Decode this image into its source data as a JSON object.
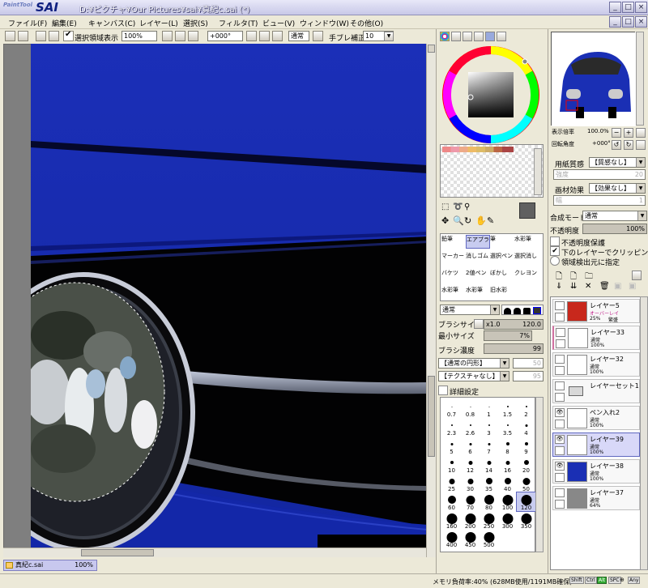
{
  "app": {
    "logo_small": "PaintTool",
    "logo_big": "SAI",
    "title": "D:¥ピクチャ¥Our Pictures¥sai¥真紀c.sai (*)"
  },
  "window_buttons": [
    "_",
    "□",
    "×"
  ],
  "menu": [
    "ファイル(F)",
    "編集(E)",
    "キャンバス(C)",
    "レイヤー(L)",
    "選択(S)",
    "フィルタ(T)",
    "ビュー(V)",
    "ウィンドウ(W)",
    "その他(O)"
  ],
  "toolbar": {
    "selection_show": "選択領域表示",
    "zoom": "100%",
    "angle": "+000°",
    "blend": "通常",
    "stabilizer_label": "手ブレ補正",
    "stabilizer_value": "10"
  },
  "navigator": {
    "zoom_label": "表示倍率",
    "zoom_value": "100.0%",
    "rotate_label": "回転角度",
    "rotate_value": "+000°"
  },
  "paper": {
    "texture_label": "用紙質感",
    "texture_value": "【質感なし】",
    "texture_sub": "強度",
    "texture_sub_value": "20",
    "effect_label": "画材効果",
    "effect_value": "【効果なし】",
    "effect_sub": "幅",
    "effect_sub_value": "1"
  },
  "layer_props": {
    "mode_label": "合成モード",
    "mode_value": "通常",
    "opacity_label": "不透明度",
    "opacity_value": "100%",
    "check1": "不透明度保護",
    "check2": "下のレイヤーでクリッピング",
    "check3": "領域検出元に指定"
  },
  "tools": [
    [
      "鉛筆",
      "エアブラシ",
      "筆",
      "水彩筆"
    ],
    [
      "マーカー",
      "消しゴム",
      "選択ペン",
      "選択消し"
    ],
    [
      "バケツ",
      "2値ペン",
      "ぼかし",
      "クレヨン"
    ],
    [
      "水彩筆",
      "水彩筆",
      "旧水彩",
      ""
    ]
  ],
  "brush_settings": {
    "mode": "通常",
    "size_label": "ブラシサイズ",
    "size_mult": "x1.0",
    "size_value": "120.0",
    "min_label": "最小サイズ",
    "min_value": "7%",
    "density_label": "ブラシ濃度",
    "density_value": "99",
    "shape": "【通常の円形】",
    "shape_value": "50",
    "texture": "【テクスチャなし】",
    "texture_value": "95",
    "detail": "詳細設定"
  },
  "brush_sizes": [
    "0.7",
    "0.8",
    "1",
    "1.5",
    "2",
    "2.3",
    "2.6",
    "3",
    "3.5",
    "4",
    "5",
    "6",
    "7",
    "8",
    "9",
    "10",
    "12",
    "14",
    "16",
    "20",
    "25",
    "30",
    "35",
    "40",
    "50",
    "60",
    "70",
    "80",
    "100",
    "120",
    "160",
    "200",
    "250",
    "300",
    "350",
    "400",
    "450",
    "500"
  ],
  "layers": [
    {
      "name": "レイヤー5",
      "mode": "オーバーレイ",
      "opacity": "25%",
      "extra": "繁盛",
      "thumb": "#c8281c",
      "eye": false
    },
    {
      "name": "レイヤー33",
      "mode": "通常",
      "opacity": "100%",
      "extra": "",
      "thumb": "#ffffff",
      "eye": false
    },
    {
      "name": "レイヤー32",
      "mode": "通常",
      "opacity": "100%",
      "extra": "",
      "thumb": "#ffffff",
      "eye": false
    },
    {
      "name": "レイヤーセット1",
      "mode": "",
      "opacity": "",
      "extra": "",
      "thumb": "folder",
      "eye": false
    },
    {
      "name": "ペン入れ2",
      "mode": "通常",
      "opacity": "100%",
      "extra": "",
      "thumb": "#ffffff",
      "eye": true
    },
    {
      "name": "レイヤー39",
      "mode": "通常",
      "opacity": "100%",
      "extra": "",
      "thumb": "#ffffff",
      "eye": true
    },
    {
      "name": "レイヤー38",
      "mode": "通常",
      "opacity": "100%",
      "extra": "",
      "thumb": "#1a2fb4",
      "eye": true
    },
    {
      "name": "レイヤー37",
      "mode": "通常",
      "opacity": "64%",
      "extra": "",
      "thumb": "#888888",
      "eye": false
    }
  ],
  "doc_tab": {
    "name": "真紀c.sai",
    "zoom": "100%"
  },
  "status": {
    "memory": "メモリ負荷率:40% (628MB使用/1191MB確保)",
    "keys": [
      "Shift",
      "Ctrl",
      "Alt",
      "SPC",
      "Any"
    ]
  },
  "colors": {
    "canvas_blue": "#1a2fb4",
    "selected_layer": "#d8d8f8",
    "chrome": "#ece9d8"
  }
}
